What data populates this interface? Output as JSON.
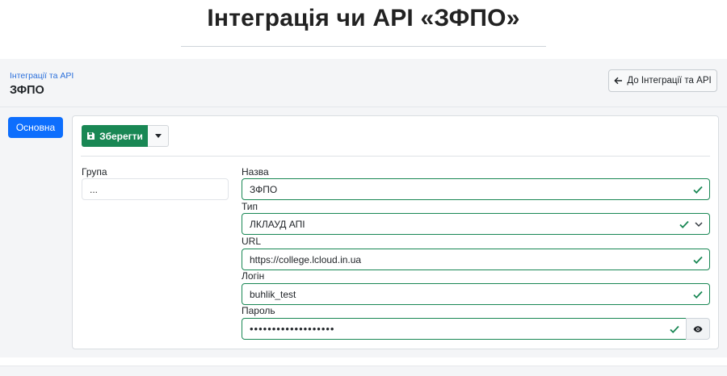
{
  "page": {
    "title": "Інтеграція чи API «ЗФПО»"
  },
  "header": {
    "breadcrumb": "Інтеграції та API",
    "record_title": "ЗФПО",
    "back_label": "До Інтеграції та API"
  },
  "tabs": [
    {
      "label": "Основна",
      "active": true
    }
  ],
  "toolbar": {
    "save_label": "Зберегти"
  },
  "form": {
    "group": {
      "label": "Група",
      "value": "..."
    },
    "name": {
      "label": "Назва",
      "value": "ЗФПО"
    },
    "type": {
      "label": "Тип",
      "value": "ЛКЛАУД АПІ"
    },
    "url": {
      "label": "URL",
      "value": "https://college.lcloud.in.ua"
    },
    "login": {
      "label": "Логін",
      "value": "buhlik_test"
    },
    "password": {
      "label": "Пароль",
      "value": "•••••••••••••••••••"
    }
  },
  "colors": {
    "primary": "#0d6efd",
    "success": "#198754",
    "band": "#f4f5f7"
  },
  "icons": {
    "back": "arrow-left-icon",
    "save": "floppy-disk-icon",
    "dropdown": "caret-down-icon",
    "valid": "check-icon",
    "select": "chevron-down-icon",
    "reveal": "eye-icon"
  }
}
